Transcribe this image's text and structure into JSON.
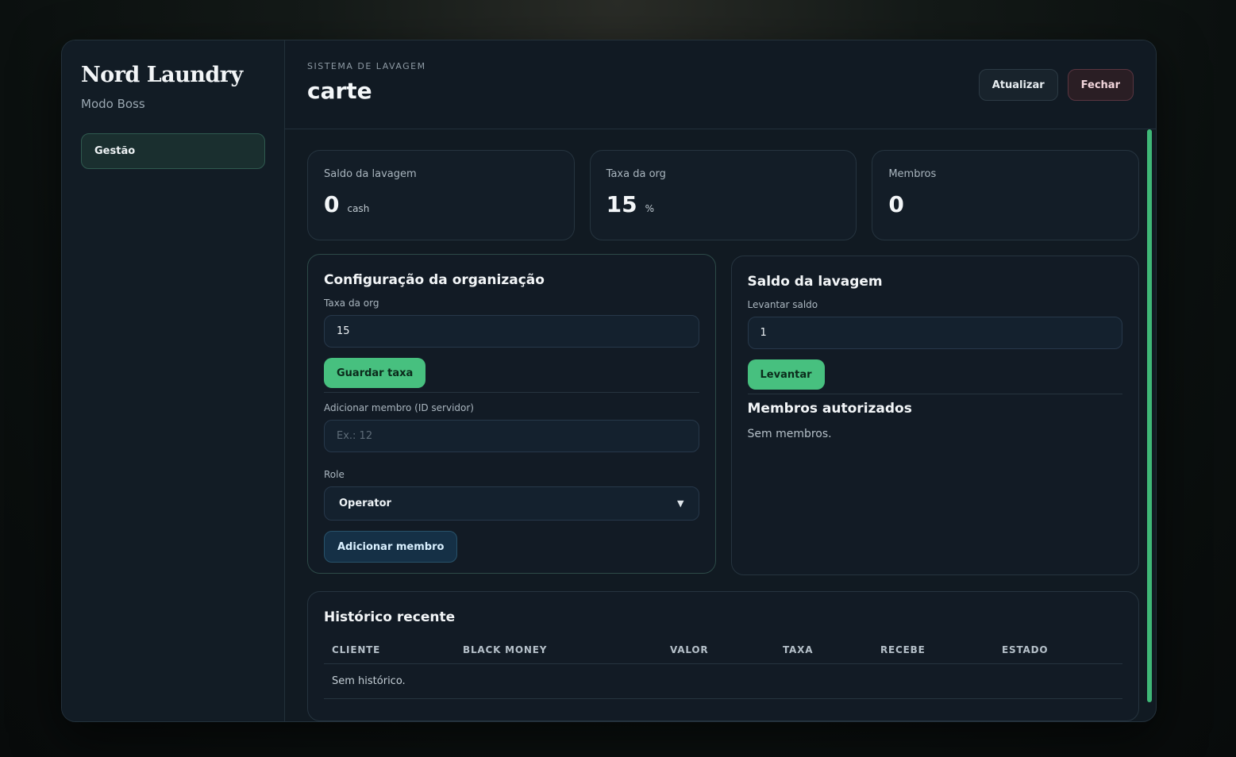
{
  "sidebar": {
    "brand": "Nord Laundry",
    "subtitle": "Modo Boss",
    "items": [
      {
        "label": "Gestão",
        "active": true
      }
    ]
  },
  "header": {
    "eyebrow": "SISTEMA DE LAVAGEM",
    "title": "carte",
    "refresh_label": "Atualizar",
    "close_label": "Fechar"
  },
  "stats": [
    {
      "label": "Saldo da lavagem",
      "value": "0",
      "unit": "cash"
    },
    {
      "label": "Taxa da org",
      "value": "15",
      "unit": "%"
    },
    {
      "label": "Membros",
      "value": "0",
      "unit": ""
    }
  ],
  "config": {
    "title": "Configuração da organização",
    "tax_label": "Taxa da org",
    "tax_value": "15",
    "save_tax_label": "Guardar taxa",
    "member_label": "Adicionar membro (ID servidor)",
    "member_placeholder": "Ex.: 12",
    "role_label": "Role",
    "role_selected": "Operator",
    "add_member_label": "Adicionar membro"
  },
  "balance": {
    "title": "Saldo da lavagem",
    "withdraw_label": "Levantar saldo",
    "withdraw_value": "1",
    "withdraw_button": "Levantar",
    "members_title": "Membros autorizados",
    "members_empty": "Sem membros."
  },
  "history": {
    "title": "Histórico recente",
    "columns": [
      "CLIENTE",
      "BLACK MONEY",
      "VALOR",
      "TAXA",
      "RECEBE",
      "ESTADO"
    ],
    "empty": "Sem histórico."
  },
  "colors": {
    "accent_green": "#47c07f",
    "danger": "#5a3540",
    "background": "#111a22"
  }
}
